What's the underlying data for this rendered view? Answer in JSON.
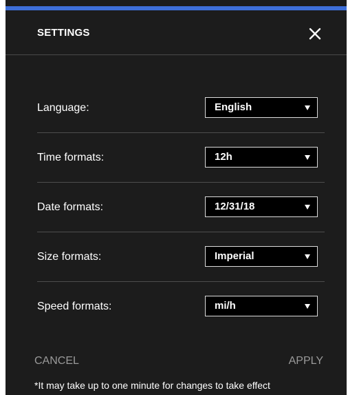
{
  "dialog": {
    "title": "SETTINGS",
    "close_icon": "close-icon",
    "accent_color": "#3e6fd8",
    "background_color": "#1c1c1c"
  },
  "settings": [
    {
      "label": "Language:",
      "value": "English"
    },
    {
      "label": "Time formats:",
      "value": "12h"
    },
    {
      "label": "Date formats:",
      "value": "12/31/18"
    },
    {
      "label": "Size formats:",
      "value": "Imperial"
    },
    {
      "label": "Speed formats:",
      "value": "mi/h"
    }
  ],
  "footer": {
    "cancel_label": "CANCEL",
    "apply_label": "APPLY",
    "note": "*It may take up to one minute for changes to take effect"
  }
}
